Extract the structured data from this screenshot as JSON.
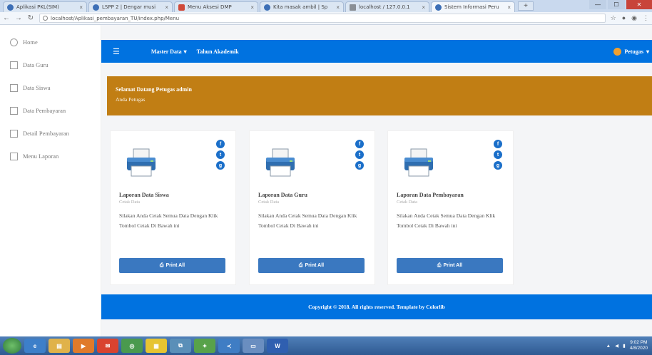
{
  "browser": {
    "tabs": [
      {
        "title": "Aplikasi PKL(SIM)",
        "favicon": "globe",
        "active": false
      },
      {
        "title": "LSPP 2 | Dengar musi",
        "favicon": "globe",
        "active": false
      },
      {
        "title": "Menu Aksesi DMP",
        "favicon": "mail",
        "active": false
      },
      {
        "title": "Kita masak ambil | Sp",
        "favicon": "globe",
        "active": false
      },
      {
        "title": "localhost / 127.0.0.1",
        "favicon": "db",
        "active": false
      },
      {
        "title": "Sistem Informasi Peru",
        "favicon": "globe",
        "active": true
      }
    ],
    "url": "localhost/Aplikasi_pembayaran_TU/index.php/Menu",
    "close_glyph": "×",
    "newtab_glyph": "+",
    "win_min": "—",
    "win_max": "☐",
    "win_close": "✕"
  },
  "sidebar": {
    "items": [
      {
        "label": "Home",
        "icon": "home-icon"
      },
      {
        "label": "Data Guru",
        "icon": "user-icon"
      },
      {
        "label": "Data Siswa",
        "icon": "users-icon"
      },
      {
        "label": "Data Pembayaran",
        "icon": "money-icon"
      },
      {
        "label": "Detail Pembayaran",
        "icon": "doc-icon"
      },
      {
        "label": "Menu Laporan",
        "icon": "report-icon"
      }
    ]
  },
  "topnav": {
    "hamburger": "☰",
    "menu_data": "Master Data",
    "tahun": "Tahun Akademik",
    "user": "Petugas"
  },
  "banner": {
    "title": "Selamat Datang Petugas admin",
    "subtitle": "Anda Petugas"
  },
  "cards": [
    {
      "title": "Laporan Data Siswa",
      "subtitle": "Cetak Data",
      "desc": "Silakan Anda Cetak Semua Data Dengan Klik Tombol Cetak Di Bawah ini",
      "button": "Print All"
    },
    {
      "title": "Laporan Data Guru",
      "subtitle": "Cetak Data",
      "desc": "Silakan Anda Cetak Semua Data Dengan Klik Tombol Cetak Di Bawah ini",
      "button": "Print All"
    },
    {
      "title": "Laporan Data Pembayaran",
      "subtitle": "Cetak Data",
      "desc": "Silakan Anda Cetak Semua Data Dengan Klik Tombol Cetak Di Bawah ini",
      "button": "Print All"
    }
  ],
  "footer": {
    "text": "Copyright © 2018. All rights reserved. Template by Colorlib"
  },
  "taskbar": {
    "time": "9:02 PM",
    "date": "4/8/2020"
  },
  "colors": {
    "nav": "#0072e0",
    "banner": "#c17e14",
    "button": "#3a78c0"
  }
}
